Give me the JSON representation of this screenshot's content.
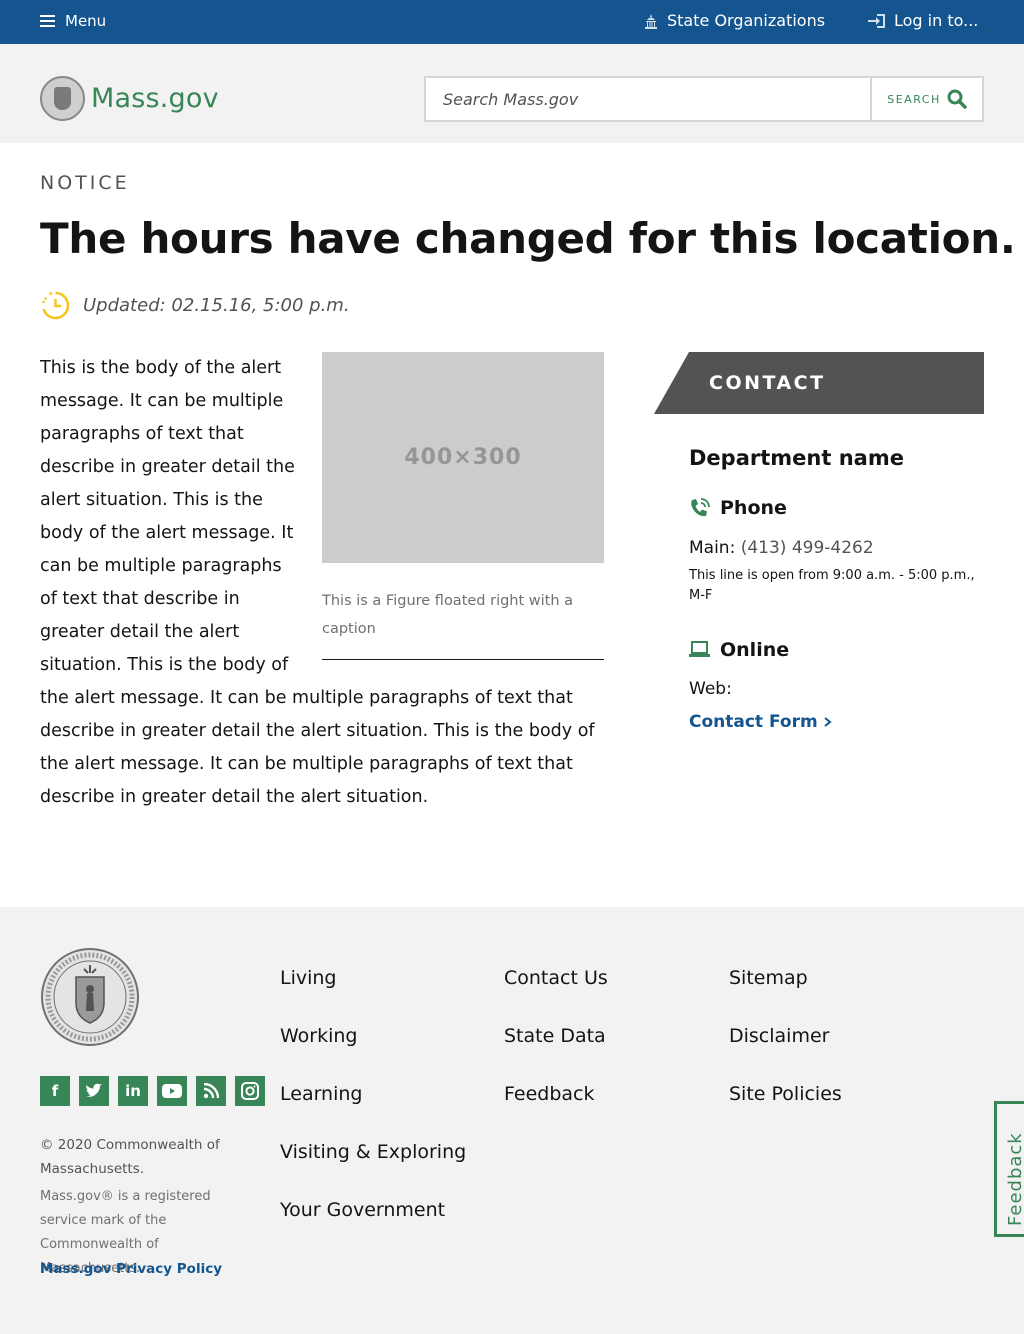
{
  "topbar": {
    "menu_label": "Menu",
    "state_orgs_label": "State Organizations",
    "login_label": "Log in to..."
  },
  "header": {
    "logo_text": "Mass.gov",
    "search_placeholder": "Search Mass.gov",
    "search_button_label": "SEARCH"
  },
  "main": {
    "eyebrow": "NOTICE",
    "title": "The hours have changed for this location.",
    "updated_label": "Updated:",
    "updated_value": "02.15.16, 5:00 p.m.",
    "body": "This is the body of the alert message. It can be multiple paragraphs of text that describe in greater detail the alert situation. This is the body of the alert message. It can be multiple paragraphs of text that describe in greater detail the alert situation. This is the body of the alert message. It can be multiple paragraphs of text that describe in greater detail the alert situation. This is the body of the alert message. It can be multiple paragraphs of text that describe in greater detail the alert situation.",
    "figure_placeholder": "400×300",
    "figure_caption": "This is a Figure floated right with a caption"
  },
  "contact": {
    "heading": "CONTACT",
    "department": "Department name",
    "phone_heading": "Phone",
    "main_label": "Main:",
    "main_number": "(413) 499-4262",
    "hours_note": "This line is open from 9:00 a.m. - 5:00 p.m., M-F",
    "online_heading": "Online",
    "web_label": "Web:",
    "contact_form_label": "Contact Form"
  },
  "footer": {
    "copyright": "© 2020 Commonwealth of Massachusetts.",
    "registered": "Mass.gov® is a registered service mark of the Commonwealth of Massachusetts.",
    "privacy_label": "Mass.gov Privacy Policy",
    "col1": [
      "Living",
      "Working",
      "Learning",
      "Visiting & Exploring",
      "Your Government"
    ],
    "col2": [
      "Contact Us",
      "State Data",
      "Feedback"
    ],
    "col3": [
      "Sitemap",
      "Disclaimer",
      "Site Policies"
    ],
    "social_icons": [
      "facebook-icon",
      "twitter-icon",
      "linkedin-icon",
      "youtube-icon",
      "rss-icon",
      "instagram-icon"
    ]
  },
  "feedback_tab_label": "Feedback",
  "colors": {
    "primary_blue": "#14558f",
    "green": "#388557",
    "light_gray": "#f2f2f2",
    "dark_gray": "#535353",
    "clock_yellow": "#f6c51b"
  }
}
